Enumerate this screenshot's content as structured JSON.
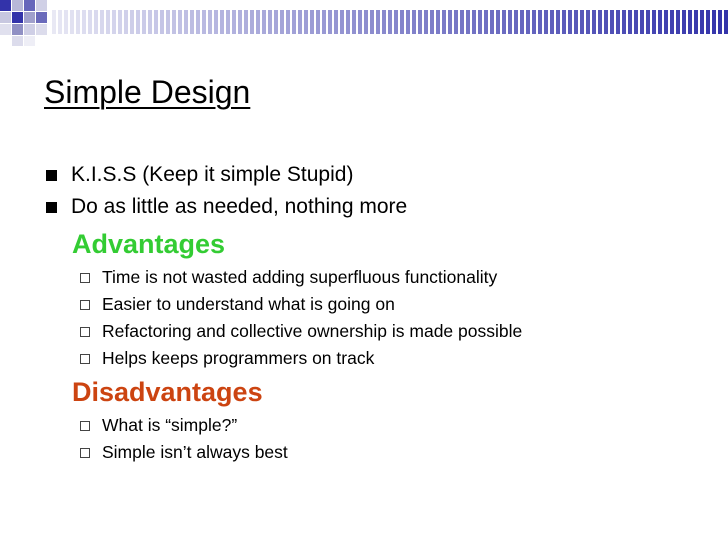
{
  "slide": {
    "title": "Simple Design",
    "bullets": [
      "K.I.S.S (Keep it simple Stupid)",
      "Do as little as needed, nothing more"
    ],
    "advantages": {
      "heading": "Advantages",
      "items": [
        "Time is not wasted adding superfluous functionality",
        "Easier to understand what is going on",
        "Refactoring and collective ownership is made possible",
        "Helps keeps programmers on track"
      ]
    },
    "disadvantages": {
      "heading": "Disadvantages",
      "items": [
        "What is “simple?”",
        "Simple isn’t always best"
      ]
    }
  },
  "colors": {
    "advantages": "#33cc33",
    "disadvantages": "#cc4411",
    "band_dark": "#3333aa",
    "band_light": "#e8e8f4"
  }
}
